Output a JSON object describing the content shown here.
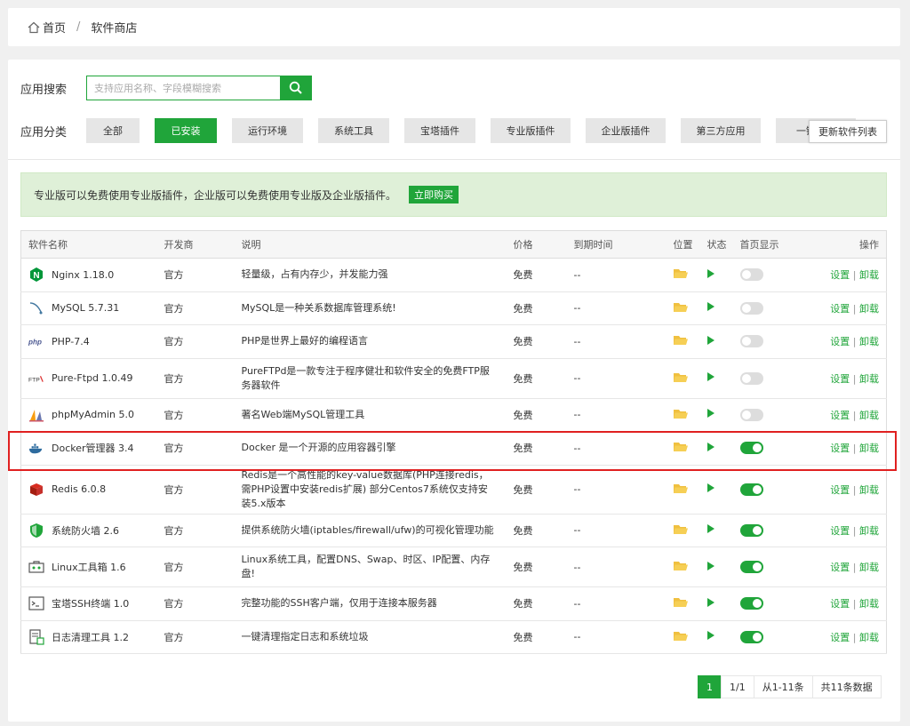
{
  "breadcrumb": {
    "home": "首页",
    "separator": "/",
    "current": "软件商店"
  },
  "search": {
    "label": "应用搜索",
    "placeholder": "支持应用名称、字段模糊搜索",
    "button_icon": "search-icon"
  },
  "categories": {
    "label": "应用分类",
    "items": [
      "全部",
      "已安装",
      "运行环境",
      "系统工具",
      "宝塔插件",
      "专业版插件",
      "企业版插件",
      "第三方应用",
      "一键部署"
    ],
    "active": "已安装",
    "update_button": "更新软件列表"
  },
  "notice": {
    "text": "专业版可以免费使用专业版插件，企业版可以免费使用专业版及企业版插件。",
    "button": "立即购买"
  },
  "table": {
    "headers": [
      "软件名称",
      "开发商",
      "说明",
      "价格",
      "到期时间",
      "位置",
      "状态",
      "首页显示",
      "操作"
    ],
    "rows": [
      {
        "icon": "nginx-icon",
        "name": "Nginx 1.18.0",
        "dev": "官方",
        "desc": "轻量级，占有内存少，并发能力强",
        "price": "免费",
        "expire": "--",
        "home_display": false
      },
      {
        "icon": "mysql-icon",
        "name": "MySQL 5.7.31",
        "dev": "官方",
        "desc": "MySQL是一种关系数据库管理系统!",
        "price": "免费",
        "expire": "--",
        "home_display": false
      },
      {
        "icon": "php-icon",
        "name": "PHP-7.4",
        "dev": "官方",
        "desc": "PHP是世界上最好的编程语言",
        "price": "免费",
        "expire": "--",
        "home_display": false
      },
      {
        "icon": "ftp-icon",
        "name": "Pure-Ftpd 1.0.49",
        "dev": "官方",
        "desc": "PureFTPd是一款专注于程序健壮和软件安全的免费FTP服务器软件",
        "price": "免费",
        "expire": "--",
        "home_display": false
      },
      {
        "icon": "phpmyadmin-icon",
        "name": "phpMyAdmin 5.0",
        "dev": "官方",
        "desc": "著名Web端MySQL管理工具",
        "price": "免费",
        "expire": "--",
        "home_display": false
      },
      {
        "icon": "docker-icon",
        "name": "Docker管理器 3.4",
        "dev": "官方",
        "desc": "Docker 是一个开源的应用容器引擎",
        "price": "免费",
        "expire": "--",
        "home_display": true
      },
      {
        "icon": "redis-icon",
        "name": "Redis 6.0.8",
        "dev": "官方",
        "desc": "Redis是一个高性能的key-value数据库(PHP连接redis，需PHP设置中安装redis扩展) 部分Centos7系统仅支持安装5.x版本",
        "price": "免费",
        "expire": "--",
        "home_display": true
      },
      {
        "icon": "firewall-icon",
        "name": "系统防火墙 2.6",
        "dev": "官方",
        "desc": "提供系统防火墙(iptables/firewall/ufw)的可视化管理功能",
        "price": "免费",
        "expire": "--",
        "home_display": true
      },
      {
        "icon": "toolbox-icon",
        "name": "Linux工具箱 1.6",
        "dev": "官方",
        "desc": "Linux系统工具，配置DNS、Swap、时区、IP配置、内存盘!",
        "price": "免费",
        "expire": "--",
        "home_display": true
      },
      {
        "icon": "terminal-icon",
        "name": "宝塔SSH终端 1.0",
        "dev": "官方",
        "desc": "完整功能的SSH客户端，仅用于连接本服务器",
        "price": "免费",
        "expire": "--",
        "home_display": true
      },
      {
        "icon": "log-clean-icon",
        "name": "日志清理工具 1.2",
        "dev": "官方",
        "desc": "一键清理指定日志和系统垃圾",
        "price": "免费",
        "expire": "--",
        "home_display": true
      }
    ],
    "ops": {
      "settings": "设置",
      "sep": "|",
      "uninstall": "卸载"
    }
  },
  "pagination": {
    "current": "1",
    "pages": "1/1",
    "range": "从1-11条",
    "total": "共11条数据"
  },
  "colors": {
    "accent": "#20a53a",
    "highlight": "#e02020",
    "notice_bg": "#dff0d8"
  }
}
